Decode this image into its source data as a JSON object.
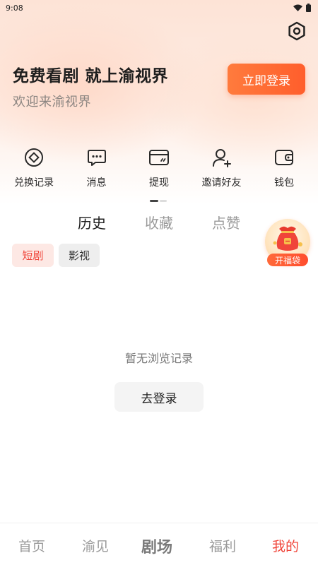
{
  "status_bar": {
    "time": "9:08"
  },
  "hero": {
    "title": "免费看剧 就上渝视界",
    "subtitle": "欢迎来渝视界",
    "login_button": "立即登录"
  },
  "quick_actions": [
    {
      "label": "兑换记录",
      "icon": "exchange-icon"
    },
    {
      "label": "消息",
      "icon": "message-icon"
    },
    {
      "label": "提现",
      "icon": "withdraw-card-icon"
    },
    {
      "label": "邀请好友",
      "icon": "invite-user-icon"
    },
    {
      "label": "钱包",
      "icon": "wallet-icon"
    }
  ],
  "tabs": [
    {
      "label": "历史",
      "active": true
    },
    {
      "label": "收藏",
      "active": false
    },
    {
      "label": "点赞",
      "active": false
    }
  ],
  "filters": [
    {
      "label": "短剧",
      "active": true
    },
    {
      "label": "影视",
      "active": false
    }
  ],
  "lucky_bag": {
    "label": "开福袋"
  },
  "empty_state": {
    "message": "暂无浏览记录",
    "button": "去登录"
  },
  "bottom_nav": [
    {
      "label": "首页"
    },
    {
      "label": "渝见"
    },
    {
      "label": "剧场"
    },
    {
      "label": "福利"
    },
    {
      "label": "我的"
    }
  ],
  "colors": {
    "accent": "#ff5e2c",
    "active_red": "#f0453a",
    "chip_active_bg": "#fde8e4"
  }
}
